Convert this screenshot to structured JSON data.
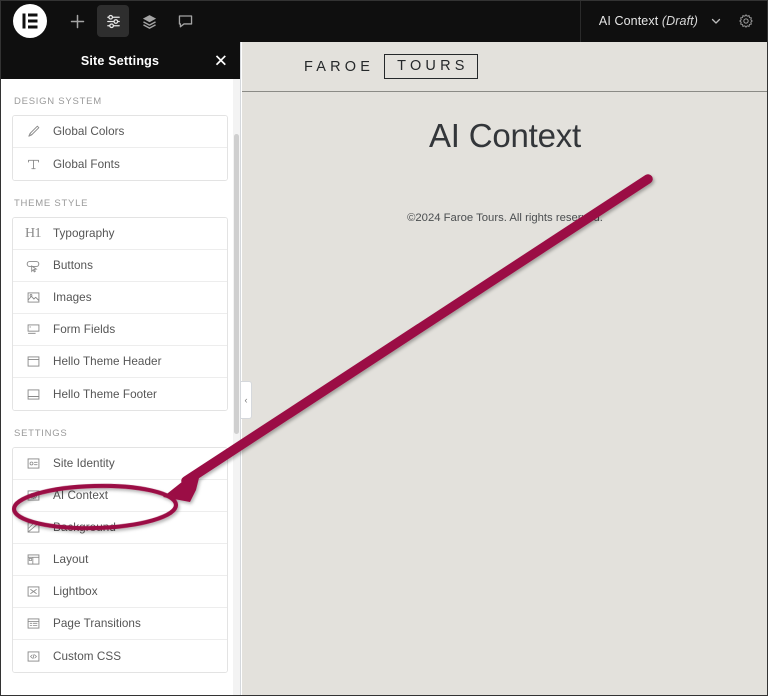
{
  "topbar": {
    "icons": [
      {
        "name": "elementor-logo-icon",
        "label": "Elementor"
      },
      {
        "name": "add-element-icon",
        "label": "Add"
      },
      {
        "name": "site-settings-sliders-icon",
        "label": "Site Settings",
        "active": true
      },
      {
        "name": "layers-navigator-icon",
        "label": "Navigator"
      },
      {
        "name": "comments-icon",
        "label": "Comments"
      }
    ],
    "document_title": "AI Context",
    "document_status": "(Draft)",
    "chevron": "chevron-down-icon",
    "settings": "gear-icon"
  },
  "panel": {
    "title": "Site Settings",
    "close_label": "✕",
    "collapse_label": "‹",
    "sections": [
      {
        "id": "design-system",
        "title": "DESIGN SYSTEM",
        "items": [
          {
            "label": "Global Colors",
            "icon": "brush-icon"
          },
          {
            "label": "Global Fonts",
            "icon": "font-t-icon"
          }
        ]
      },
      {
        "id": "theme-style",
        "title": "THEME STYLE",
        "items": [
          {
            "label": "Typography",
            "icon": "h1-typography-icon"
          },
          {
            "label": "Buttons",
            "icon": "button-cursor-icon"
          },
          {
            "label": "Images",
            "icon": "image-icon"
          },
          {
            "label": "Form Fields",
            "icon": "form-field-icon"
          },
          {
            "label": "Hello Theme Header",
            "icon": "header-block-icon"
          },
          {
            "label": "Hello Theme Footer",
            "icon": "footer-block-icon"
          }
        ]
      },
      {
        "id": "settings",
        "title": "SETTINGS",
        "items": [
          {
            "label": "Site Identity",
            "icon": "site-identity-icon"
          },
          {
            "label": "AI Context",
            "icon": "ai-context-gear-icon",
            "highlighted": true
          },
          {
            "label": "Background",
            "icon": "background-icon"
          },
          {
            "label": "Layout",
            "icon": "layout-icon"
          },
          {
            "label": "Lightbox",
            "icon": "lightbox-icon"
          },
          {
            "label": "Page Transitions",
            "icon": "page-transitions-icon"
          },
          {
            "label": "Custom CSS",
            "icon": "custom-css-icon"
          }
        ]
      }
    ]
  },
  "preview": {
    "brand_primary": "FAROE",
    "brand_boxed": "TOURS",
    "page_title": "AI Context",
    "copyright": "©2024 Faroe Tours. All rights reserved."
  },
  "annotation": {
    "color": "#9b1144",
    "arrow_label": "arrow pointing to AI Context",
    "ellipse_label": "ellipse highlighting AI Context"
  }
}
